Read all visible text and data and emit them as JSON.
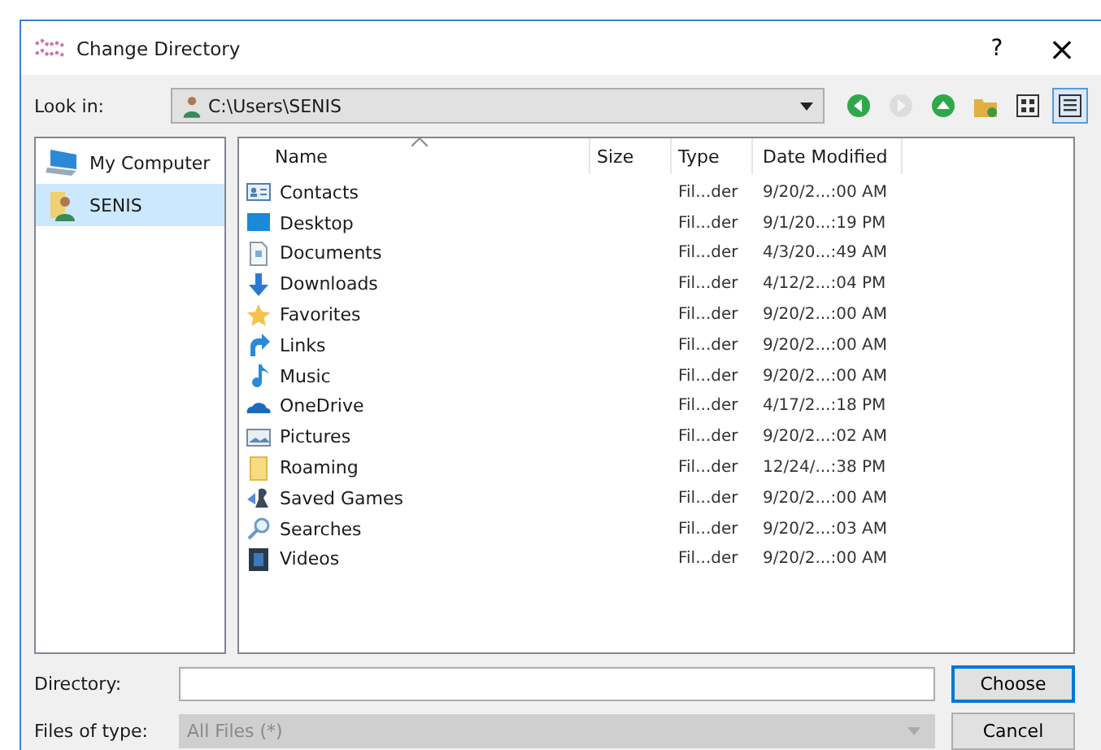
{
  "window": {
    "title": "Change Directory",
    "help": "?",
    "close": "×"
  },
  "look_in": {
    "label": "Look in:",
    "path": "C:\\Users\\SENIS"
  },
  "toolbar": [
    {
      "kind": "back",
      "disabled": false,
      "selected": false
    },
    {
      "kind": "forward",
      "disabled": true,
      "selected": false
    },
    {
      "kind": "up",
      "disabled": false,
      "selected": false
    },
    {
      "kind": "new-folder",
      "disabled": false,
      "selected": false
    },
    {
      "kind": "list-view",
      "disabled": false,
      "selected": false
    },
    {
      "kind": "detail-view",
      "disabled": false,
      "selected": true
    }
  ],
  "sidebar": {
    "items": [
      {
        "label": "My Computer",
        "kind": "computer",
        "selected": false
      },
      {
        "label": "SENIS",
        "kind": "user",
        "selected": true
      }
    ]
  },
  "table": {
    "columns": [
      "Name",
      "Size",
      "Type",
      "Date Modified"
    ],
    "rows": [
      {
        "kind": "contacts",
        "name": "Contacts",
        "type": "Fil...der",
        "date": "9/20/2...:00 AM"
      },
      {
        "kind": "desktop",
        "name": "Desktop",
        "type": "Fil...der",
        "date": "9/1/20...:19 PM"
      },
      {
        "kind": "documents",
        "name": "Documents",
        "type": "Fil...der",
        "date": "4/3/20...:49 AM"
      },
      {
        "kind": "downloads",
        "name": "Downloads",
        "type": "Fil...der",
        "date": "4/12/2...:04 PM"
      },
      {
        "kind": "favorites",
        "name": "Favorites",
        "type": "Fil...der",
        "date": "9/20/2...:00 AM"
      },
      {
        "kind": "links",
        "name": "Links",
        "type": "Fil...der",
        "date": "9/20/2...:00 AM"
      },
      {
        "kind": "music",
        "name": "Music",
        "type": "Fil...der",
        "date": "9/20/2...:00 AM"
      },
      {
        "kind": "cloud",
        "name": "OneDrive",
        "type": "Fil...der",
        "date": "4/17/2...:18 PM"
      },
      {
        "kind": "pictures",
        "name": "Pictures",
        "type": "Fil...der",
        "date": "9/20/2...:02 AM"
      },
      {
        "kind": "folder",
        "name": "Roaming",
        "type": "Fil...der",
        "date": "12/24/...:38 PM"
      },
      {
        "kind": "games",
        "name": "Saved Games",
        "type": "Fil...der",
        "date": "9/20/2...:00 AM"
      },
      {
        "kind": "searches",
        "name": "Searches",
        "type": "Fil...der",
        "date": "9/20/2...:03 AM"
      },
      {
        "kind": "videos",
        "name": "Videos",
        "type": "Fil...der",
        "date": "9/20/2...:00 AM"
      }
    ]
  },
  "directory": {
    "label": "Directory:"
  },
  "file_type": {
    "label": "Files of type:",
    "value": "All Files (*)",
    "disabled": true
  },
  "buttons": [
    "Choose",
    "Cancel"
  ]
}
